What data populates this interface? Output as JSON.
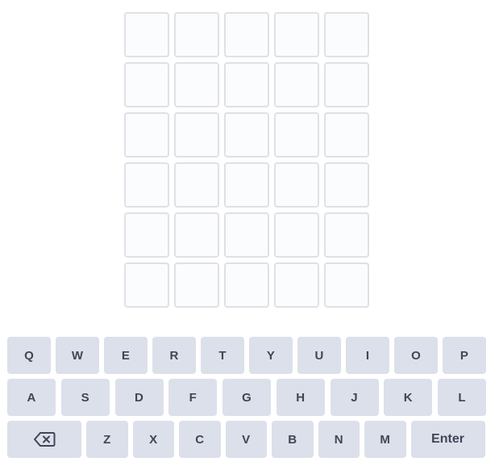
{
  "board": {
    "rows": [
      [
        "",
        "",
        "",
        "",
        ""
      ],
      [
        "",
        "",
        "",
        "",
        ""
      ],
      [
        "",
        "",
        "",
        "",
        ""
      ],
      [
        "",
        "",
        "",
        "",
        ""
      ],
      [
        "",
        "",
        "",
        "",
        ""
      ],
      [
        "",
        "",
        "",
        "",
        ""
      ]
    ]
  },
  "keyboard": {
    "row1": [
      "Q",
      "W",
      "E",
      "R",
      "T",
      "Y",
      "U",
      "I",
      "O",
      "P"
    ],
    "row2": [
      "A",
      "S",
      "D",
      "F",
      "G",
      "H",
      "J",
      "K",
      "L"
    ],
    "row3": [
      "Z",
      "X",
      "C",
      "V",
      "B",
      "N",
      "M"
    ],
    "backspace_icon": "backspace-icon",
    "enter_label": "Enter"
  },
  "colors": {
    "tile_border": "#dfe1e6",
    "tile_bg": "#fbfcfe",
    "key_bg": "#dce0ea",
    "key_text": "#3f4657"
  }
}
